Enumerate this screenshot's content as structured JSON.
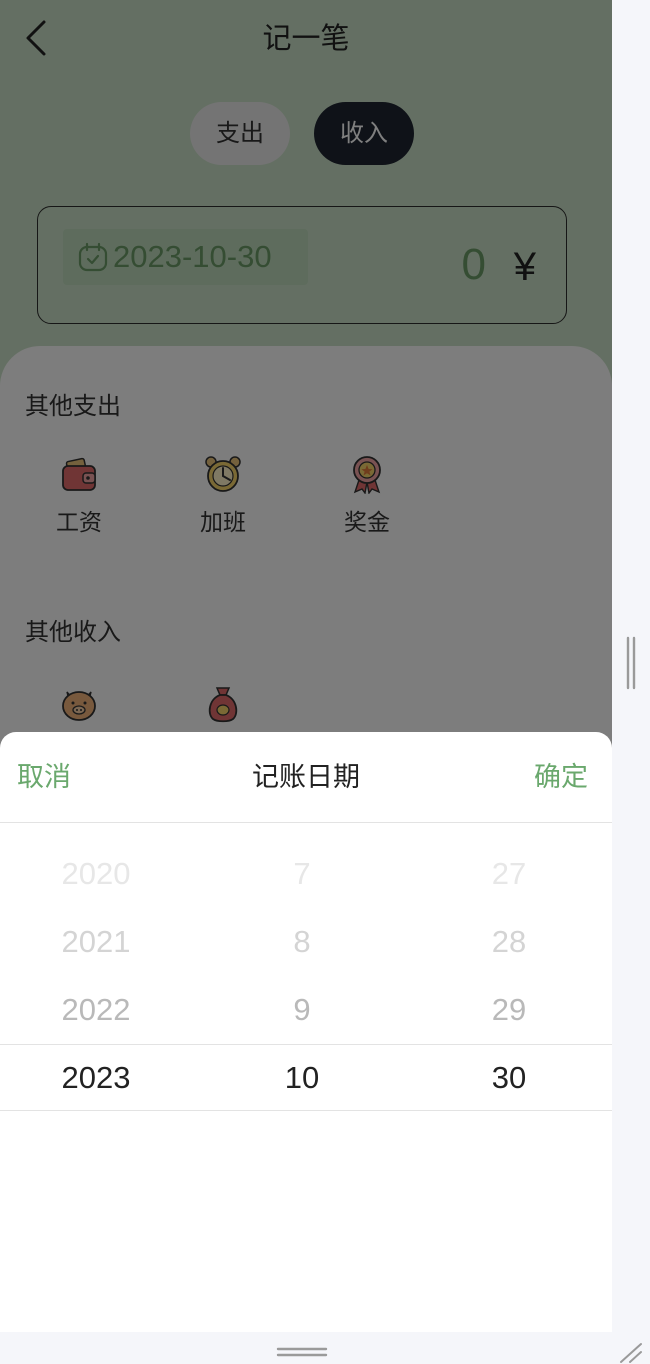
{
  "header": {
    "title": "记一笔"
  },
  "segment": {
    "expense": "支出",
    "income": "收入",
    "active": "income"
  },
  "amount_card": {
    "date": "2023-10-30",
    "amount": "0",
    "currency": "¥"
  },
  "sections": [
    {
      "title": "其他支出",
      "items": [
        {
          "label": "工资",
          "icon": "wallet-icon"
        },
        {
          "label": "加班",
          "icon": "alarm-clock-icon"
        },
        {
          "label": "奖金",
          "icon": "medal-icon"
        }
      ]
    },
    {
      "title": "其他收入",
      "items": [
        {
          "label": "",
          "icon": "piggy-bank-icon"
        },
        {
          "label": "",
          "icon": "money-bag-icon"
        }
      ]
    }
  ],
  "picker": {
    "cancel": "取消",
    "title": "记账日期",
    "confirm": "确定",
    "years": [
      "2020",
      "2021",
      "2022",
      "2023"
    ],
    "months": [
      "7",
      "8",
      "9",
      "10"
    ],
    "days": [
      "27",
      "28",
      "29",
      "30"
    ],
    "selected": {
      "year": "2023",
      "month": "10",
      "day": "30"
    }
  },
  "colors": {
    "accent": "#6aa86d",
    "dark": "#1e2531",
    "top_bg": "#c9dfc6"
  }
}
